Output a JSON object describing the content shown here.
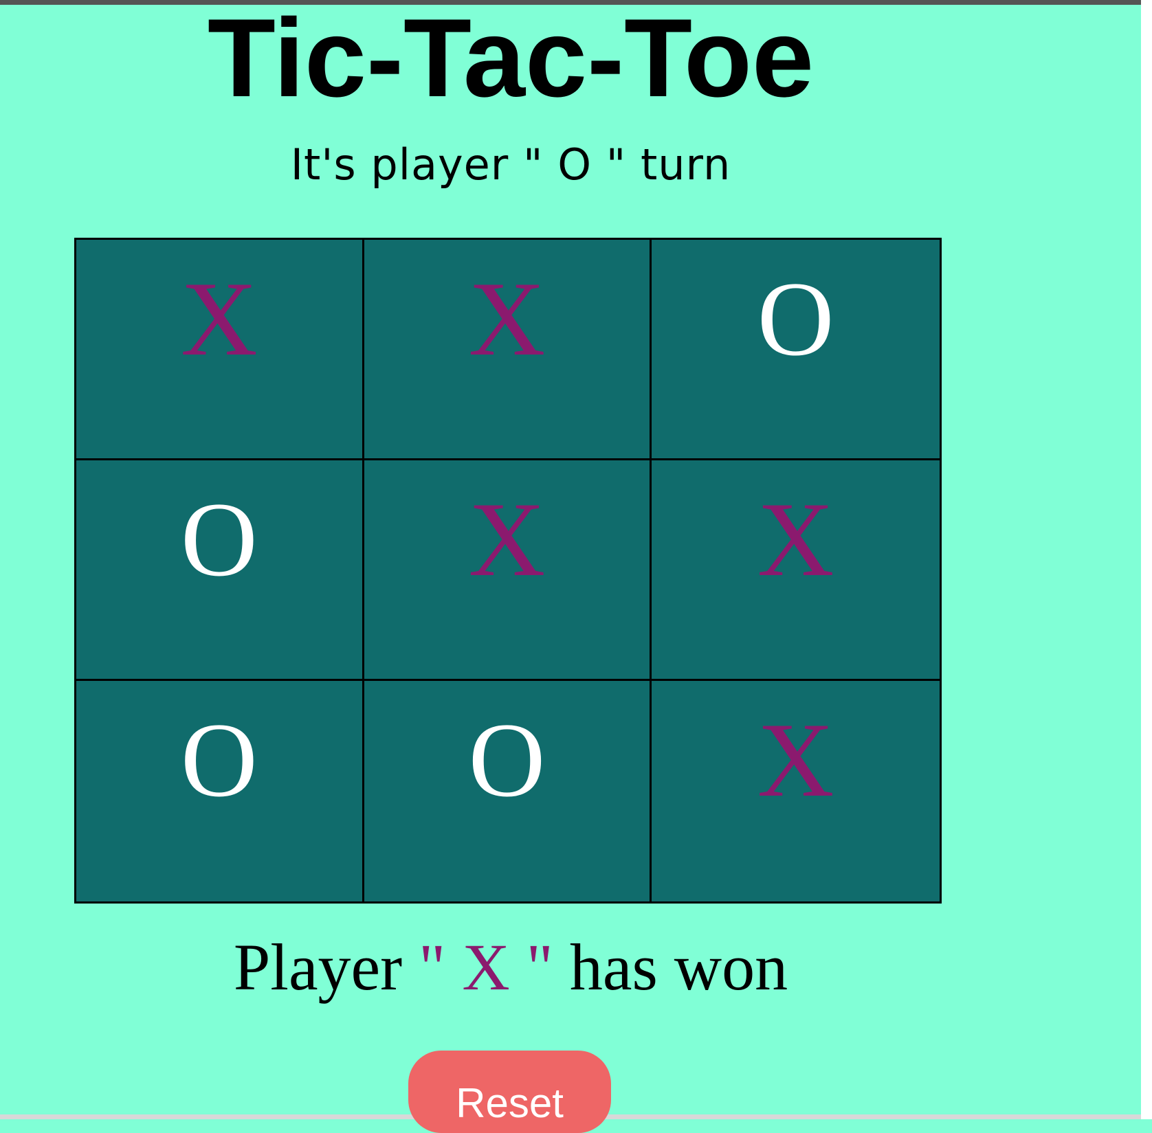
{
  "title": "Tic-Tac-Toe",
  "turn_message": "It's player \" O \" turn",
  "board": [
    [
      "X",
      "X",
      "O"
    ],
    [
      "O",
      "X",
      "X"
    ],
    [
      "O",
      "O",
      "X"
    ]
  ],
  "result": {
    "prefix": "Player ",
    "winner_open_quote": "\" ",
    "winner": "X",
    "winner_close_quote": " \"",
    "suffix": " has won"
  },
  "reset_label": "Reset",
  "colors": {
    "page_background": "#80ffd6",
    "board_cell": "#106c6c",
    "x_mark": "#8b1a6e",
    "o_mark": "#ffffff",
    "reset_button": "#ee6666"
  }
}
